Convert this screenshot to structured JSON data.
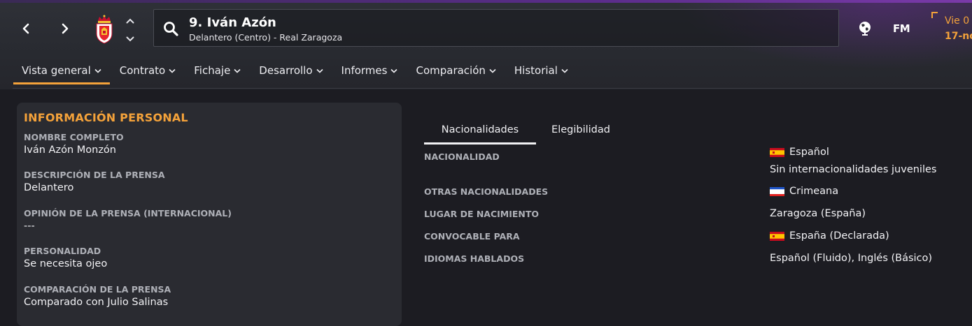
{
  "header": {
    "player_title": "9. Iván Azón",
    "player_subtitle": "Delantero (Centro) - Real Zaragoza",
    "fm_label": "FM",
    "date_day": "Vie 0",
    "date_date": "17-no"
  },
  "tabs": [
    {
      "label": "Vista general",
      "active": true
    },
    {
      "label": "Contrato",
      "active": false
    },
    {
      "label": "Fichaje",
      "active": false
    },
    {
      "label": "Desarrollo",
      "active": false
    },
    {
      "label": "Informes",
      "active": false
    },
    {
      "label": "Comparación",
      "active": false
    },
    {
      "label": "Historial",
      "active": false
    }
  ],
  "personal_info": {
    "title": "INFORMACIÓN PERSONAL",
    "items": [
      {
        "label": "NOMBRE COMPLETO",
        "value": "Iván Azón Monzón"
      },
      {
        "label": "DESCRIPCIÓN DE LA PRENSA",
        "value": "Delantero"
      },
      {
        "label": "OPINIÓN DE LA PRENSA (INTERNACIONAL)",
        "value": "---"
      },
      {
        "label": "PERSONALIDAD",
        "value": "Se necesita ojeo"
      },
      {
        "label": "COMPARACIÓN DE LA PRENSA",
        "value": "Comparado con Julio Salinas"
      }
    ]
  },
  "subtabs": [
    {
      "label": "Nacionalidades",
      "active": true
    },
    {
      "label": "Elegibilidad",
      "active": false
    }
  ],
  "nationality": {
    "rows": [
      {
        "label": "NACIONALIDAD",
        "value": "Español",
        "flag": "spain",
        "extra": "Sin internacionalidades juveniles"
      },
      {
        "label": "OTRAS NACIONALIDADES",
        "value": "Crimeana",
        "flag": "crimea"
      },
      {
        "label": "LUGAR DE NACIMIENTO",
        "value": "Zaragoza (España)"
      },
      {
        "label": "CONVOCABLE PARA",
        "value": "España (Declarada)",
        "flag": "spain"
      },
      {
        "label": "IDIOMAS HABLADOS",
        "value": "Español (Fluido), Inglés (Básico)"
      }
    ]
  },
  "colors": {
    "accent": "#f4a23a",
    "background": "#1c1c22",
    "panel": "#2a2b31"
  },
  "icons": [
    "back-arrow-icon",
    "forward-arrow-icon",
    "club-crest-icon",
    "up-down-chevron-icon",
    "search-icon",
    "globe-icon",
    "chevron-down-icon"
  ]
}
